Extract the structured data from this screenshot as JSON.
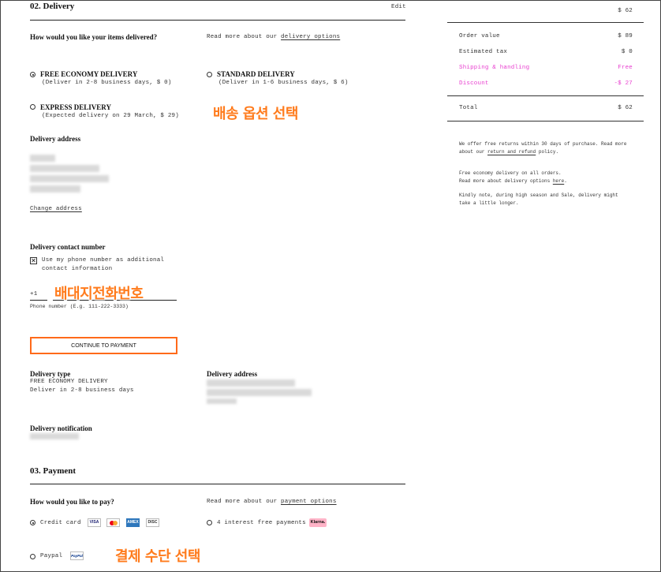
{
  "delivery": {
    "section_title": "02. Delivery",
    "edit_label": "Edit",
    "question": "How would you like your items delivered?",
    "read_more_prefix": "Read more about our",
    "read_more_link": "delivery options",
    "options": [
      {
        "label": "FREE ECONOMY DELIVERY",
        "detail": "(Deliver in 2-8 business days, $ 0)",
        "selected": true
      },
      {
        "label": "STANDARD DELIVERY",
        "detail": "(Deliver in 1-6 business days, $ 6)",
        "selected": false
      },
      {
        "label": "EXPRESS DELIVERY",
        "detail": "(Expected delivery on 29 March, $ 29)",
        "selected": false
      }
    ],
    "address_title": "Delivery address",
    "change_address": "Change address",
    "contact_title": "Delivery contact number",
    "use_phone_label_1": "Use my phone number as additional",
    "use_phone_label_2": "contact information",
    "use_phone_checked": true,
    "country_code": "+1",
    "phone_hint": "Phone number (E.g. 111-222-3333)",
    "continue_button": "CONTINUE TO PAYMENT",
    "type_title": "Delivery type",
    "type_value_1": "FREE ECONOMY DELIVERY",
    "type_value_2": "Deliver in 2-8 business days",
    "summary_address_title": "Delivery address",
    "notification_title": "Delivery notification"
  },
  "payment": {
    "section_title": "03. Payment",
    "question": "How would you like to pay?",
    "read_more_prefix": "Read more about our",
    "read_more_link": "payment options",
    "credit_card_label": "Credit card",
    "interest_free_label": "4 interest free payments",
    "klarna_label": "Klarna.",
    "paypal_label": "Paypal",
    "paypal_badge": "PayPal",
    "cards": [
      "VISA",
      "MC",
      "AMEX",
      "DISC"
    ]
  },
  "summary": {
    "top_value": "$ 62",
    "rows": [
      {
        "label": "Order value",
        "value": "$ 89",
        "highlight": false
      },
      {
        "label": "Estimated tax",
        "value": "$ 0",
        "highlight": false
      },
      {
        "label": "Shipping & handling",
        "value": "Free",
        "highlight": true
      },
      {
        "label": "Discount",
        "value": "-$ 27",
        "highlight": true
      }
    ],
    "total_label": "Total",
    "total_value": "$ 62",
    "returns_1": "We offer free returns within 30 days of purchase. Read more",
    "returns_2_prefix": "about our",
    "returns_2_link": "return and refund",
    "returns_2_suffix": "policy.",
    "note_1": "Free economy delivery on all orders.",
    "note_2_prefix": "Read more about delivery options",
    "note_2_link": "here",
    "note_3": "Kindly note, during high season and Sale, delivery might",
    "note_4": "take a little longer."
  },
  "annotations": {
    "delivery_option": "배송 옵션 선택",
    "phone_number": "배대지전화번호",
    "payment_method": "결제 수단 선택"
  },
  "colors": {
    "annotation": "#ff7b1c",
    "button_border": "#ff6a1a",
    "highlight": "#e83ecf"
  }
}
